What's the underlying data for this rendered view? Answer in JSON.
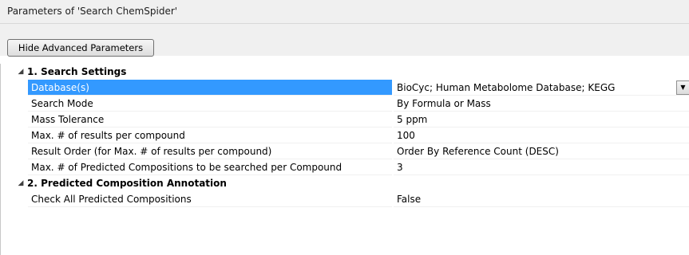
{
  "window": {
    "title": "Parameters of 'Search ChemSpider'"
  },
  "toolbar": {
    "toggle_label": "Hide Advanced Parameters"
  },
  "icons": {
    "expand": "collapse-triangle-icon",
    "dropdown": "dropdown-arrow-icon"
  },
  "colors": {
    "selection": "#3399ff"
  },
  "glyphs": {
    "expanded": "◢",
    "dropdown": "▼"
  },
  "categories": [
    {
      "label": "1. Search Settings",
      "properties": [
        {
          "name": "Database(s)",
          "value": "BioCyc; Human Metabolome Database; KEGG"
        },
        {
          "name": "Search Mode",
          "value": "By Formula or Mass"
        },
        {
          "name": "Mass Tolerance",
          "value": "5 ppm"
        },
        {
          "name": "Max. # of results per compound",
          "value": "100"
        },
        {
          "name": "Result Order (for Max. # of results per compound)",
          "value": "Order By Reference Count (DESC)"
        },
        {
          "name": "Max. # of Predicted Compositions to be searched per Compound",
          "value": "3"
        }
      ]
    },
    {
      "label": "2. Predicted Composition Annotation",
      "properties": [
        {
          "name": "Check All Predicted Compositions",
          "value": "False"
        }
      ]
    }
  ]
}
